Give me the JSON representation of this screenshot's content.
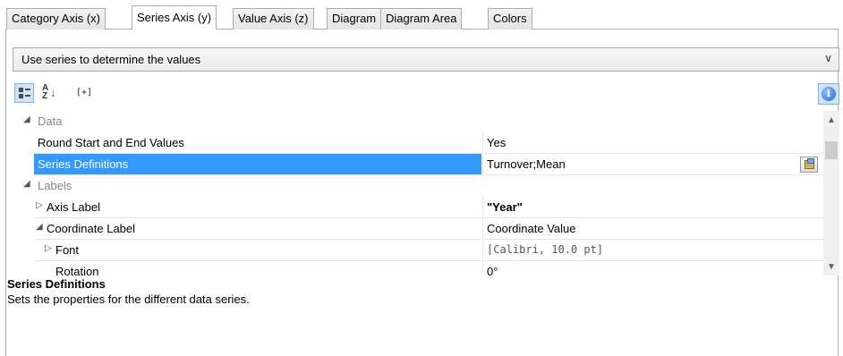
{
  "tabs": [
    {
      "label": "Category Axis (x)",
      "active": false
    },
    {
      "label": "Series Axis (y)",
      "active": true
    },
    {
      "label": "Value Axis (z)",
      "active": false
    },
    {
      "label": "Diagram",
      "active": false
    },
    {
      "label": "Diagram Area",
      "active": false
    },
    {
      "label": "Colors",
      "active": false
    }
  ],
  "dropdown": {
    "selected": "Use series to determine the values"
  },
  "toolbar": {
    "categorized_icon": "categorized-icon",
    "sort_icon": "sort-az-icon",
    "expand_label": "[+]",
    "info_icon": "info-icon",
    "info_glyph": "i"
  },
  "grid": {
    "data_category": "Data",
    "round_label": "Round Start and End Values",
    "round_value": "Yes",
    "series_label": "Series Definitions",
    "series_value": "Turnover;Mean",
    "labels_category": "Labels",
    "axis_label": "Axis Label",
    "axis_value": "\"Year\"",
    "coord_label": "Coordinate Label",
    "coord_value": "Coordinate Value",
    "font_label": "Font",
    "font_value": "[Calibri, 10.0 pt]",
    "rotation_label": "Rotation",
    "rotation_value": "0°"
  },
  "description": {
    "title": "Series Definitions",
    "text": "Sets the properties for the different data series."
  },
  "colors": {
    "selection": "#3399ff",
    "pressed_button": "#cde4f7",
    "category_text": "#888888"
  }
}
